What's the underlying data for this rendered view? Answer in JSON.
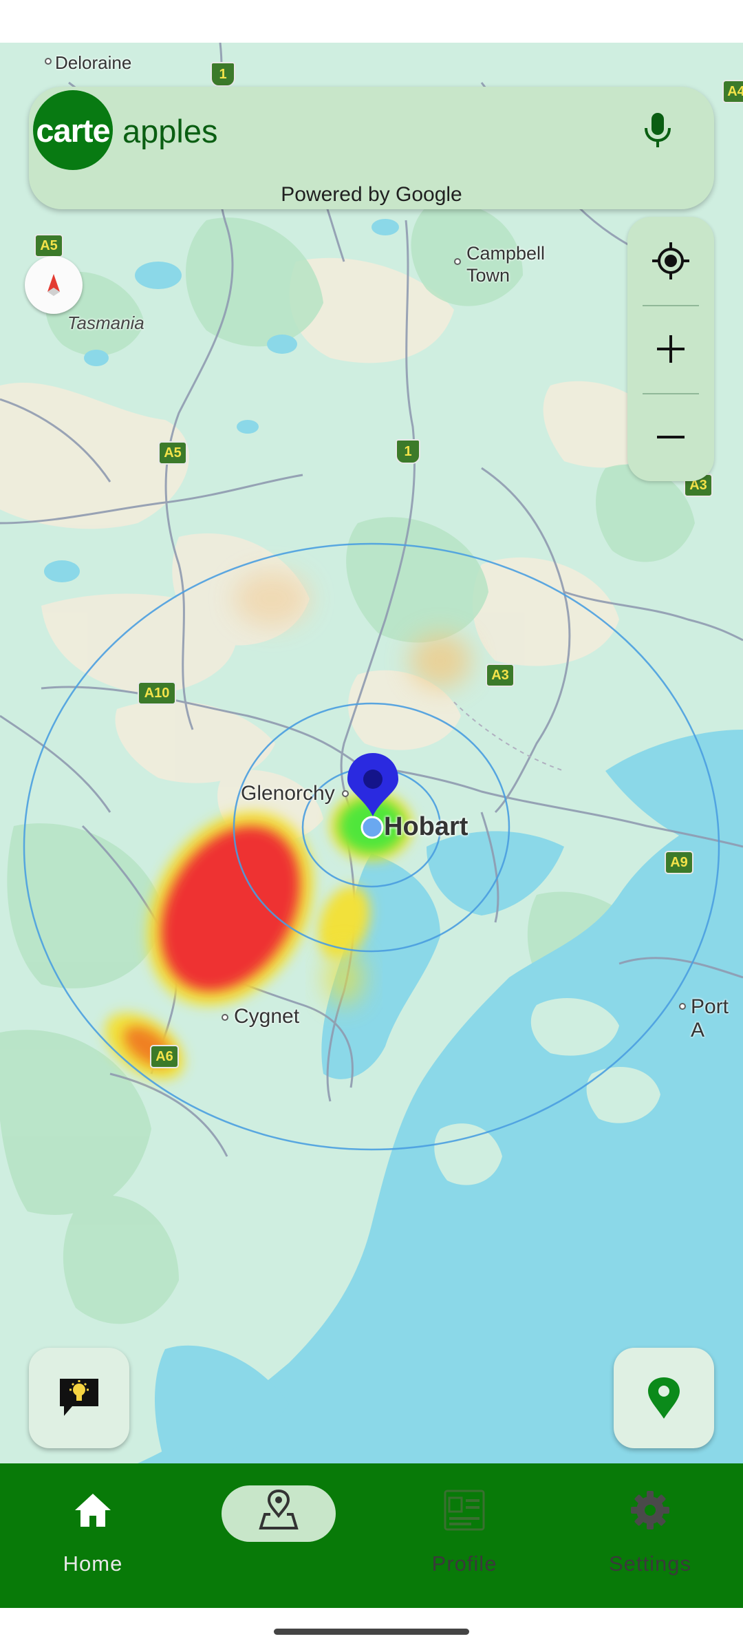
{
  "search": {
    "logo_text": "carte",
    "query": "apples",
    "powered_by": "Powered by Google",
    "mic_icon": "microphone-icon"
  },
  "map": {
    "place_labels": {
      "deloraine": "Deloraine",
      "campbell_town_line1": "Campbell",
      "campbell_town_line2": "Town",
      "tasmania": "Tasmania",
      "glenorchy": "Glenorchy",
      "hobart": "Hobart",
      "cygnet": "Cygnet",
      "port": "Port A"
    },
    "road_shields": {
      "a5_top": "A5",
      "a5_mid": "A5",
      "one_top": "1",
      "one_mid": "1",
      "a4": "A4",
      "a3_right": "A3",
      "a3_mid": "A3",
      "a10": "A10",
      "a9": "A9",
      "a6": "A6"
    },
    "colors": {
      "land": "#cfeee0",
      "water": "#8bd8e8",
      "heat_high": "#ee3030",
      "heat_mid": "#f2e13a",
      "heat_low": "#4fe63a",
      "marker": "#2a2ae0",
      "radius_ring": "#4a9ee0"
    }
  },
  "controls": {
    "compass_icon": "compass-icon",
    "my_location_icon": "my-location-icon",
    "zoom_in_icon": "plus-icon",
    "zoom_out_icon": "minus-icon",
    "ideas_icon": "lightbulb-chat-icon",
    "pin_icon": "location-pin-icon"
  },
  "bottom_nav": {
    "items": [
      {
        "label": "Home",
        "icon": "home-icon",
        "active": false
      },
      {
        "label": "",
        "icon": "map-pin-icon",
        "active": true
      },
      {
        "label": "Profile",
        "icon": "profile-card-icon",
        "active": false
      },
      {
        "label": "Settings",
        "icon": "gear-icon",
        "active": false
      }
    ]
  }
}
